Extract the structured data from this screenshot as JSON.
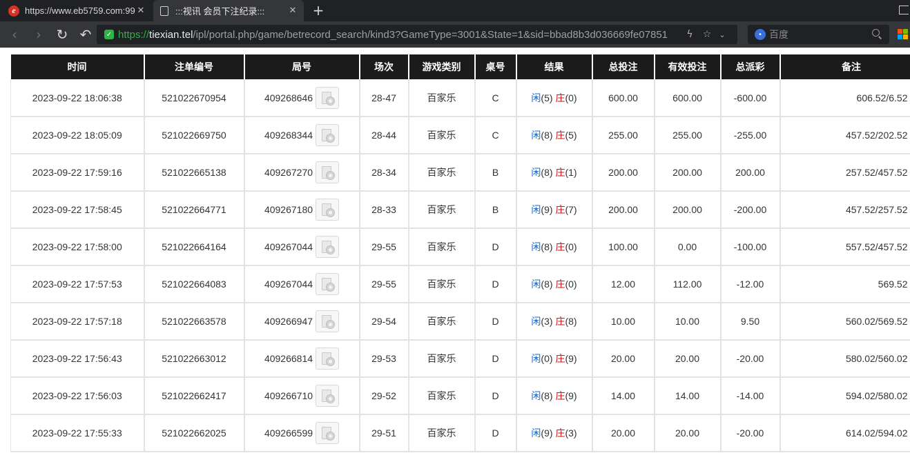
{
  "browser": {
    "tabs": [
      {
        "title": "https://www.eb5759.com:99",
        "active": false,
        "icon": "ie-logo-icon"
      },
      {
        "title": ":::视讯 会员下注纪录:::",
        "active": true,
        "icon": "document-icon"
      }
    ],
    "url": {
      "scheme": "https://",
      "host": "tiexian.tel",
      "path": "/ipl/portal.php/game/betrecord_search/kind3?GameType=3001&State=1&sid=bbad8b3d036669fe07851"
    },
    "search": {
      "placeholder": "百度"
    }
  },
  "table": {
    "headers": [
      "时间",
      "注单编号",
      "局号",
      "场次",
      "游戏类别",
      "桌号",
      "结果",
      "总投注",
      "有效投注",
      "总派彩",
      "备注"
    ],
    "rows": [
      {
        "time": "2023-09-22 18:06:38",
        "bet_id": "521022670954",
        "round": "409268646",
        "shoe": "28-47",
        "game": "百家乐",
        "table": "C",
        "player_label": "闲",
        "player_score": "(5)",
        "banker_label": "庄",
        "banker_score": "(0)",
        "total_bet": "600.00",
        "valid_bet": "600.00",
        "payout": "-600.00",
        "payout_sign": "neg",
        "note": "606.52/6.52"
      },
      {
        "time": "2023-09-22 18:05:09",
        "bet_id": "521022669750",
        "round": "409268344",
        "shoe": "28-44",
        "game": "百家乐",
        "table": "C",
        "player_label": "闲",
        "player_score": "(8)",
        "banker_label": "庄",
        "banker_score": "(5)",
        "total_bet": "255.00",
        "valid_bet": "255.00",
        "payout": "-255.00",
        "payout_sign": "neg",
        "note": "457.52/202.52"
      },
      {
        "time": "2023-09-22 17:59:16",
        "bet_id": "521022665138",
        "round": "409267270",
        "shoe": "28-34",
        "game": "百家乐",
        "table": "B",
        "player_label": "闲",
        "player_score": "(8)",
        "banker_label": "庄",
        "banker_score": "(1)",
        "total_bet": "200.00",
        "valid_bet": "200.00",
        "payout": "200.00",
        "payout_sign": "pos",
        "note": "257.52/457.52"
      },
      {
        "time": "2023-09-22 17:58:45",
        "bet_id": "521022664771",
        "round": "409267180",
        "shoe": "28-33",
        "game": "百家乐",
        "table": "B",
        "player_label": "闲",
        "player_score": "(9)",
        "banker_label": "庄",
        "banker_score": "(7)",
        "total_bet": "200.00",
        "valid_bet": "200.00",
        "payout": "-200.00",
        "payout_sign": "neg",
        "note": "457.52/257.52"
      },
      {
        "time": "2023-09-22 17:58:00",
        "bet_id": "521022664164",
        "round": "409267044",
        "shoe": "29-55",
        "game": "百家乐",
        "table": "D",
        "player_label": "闲",
        "player_score": "(8)",
        "banker_label": "庄",
        "banker_score": "(0)",
        "total_bet": "100.00",
        "valid_bet": "0.00",
        "payout": "-100.00",
        "payout_sign": "neg",
        "note": "557.52/457.52"
      },
      {
        "time": "2023-09-22 17:57:53",
        "bet_id": "521022664083",
        "round": "409267044",
        "shoe": "29-55",
        "game": "百家乐",
        "table": "D",
        "player_label": "闲",
        "player_score": "(8)",
        "banker_label": "庄",
        "banker_score": "(0)",
        "total_bet": "12.00",
        "valid_bet": "112.00",
        "payout": "-12.00",
        "payout_sign": "neg",
        "note": "569.52"
      },
      {
        "time": "2023-09-22 17:57:18",
        "bet_id": "521022663578",
        "round": "409266947",
        "shoe": "29-54",
        "game": "百家乐",
        "table": "D",
        "player_label": "闲",
        "player_score": "(3)",
        "banker_label": "庄",
        "banker_score": "(8)",
        "total_bet": "10.00",
        "valid_bet": "10.00",
        "payout": "9.50",
        "payout_sign": "pos",
        "note": "560.02/569.52"
      },
      {
        "time": "2023-09-22 17:56:43",
        "bet_id": "521022663012",
        "round": "409266814",
        "shoe": "29-53",
        "game": "百家乐",
        "table": "D",
        "player_label": "闲",
        "player_score": "(0)",
        "banker_label": "庄",
        "banker_score": "(9)",
        "total_bet": "20.00",
        "valid_bet": "20.00",
        "payout": "-20.00",
        "payout_sign": "neg",
        "note": "580.02/560.02"
      },
      {
        "time": "2023-09-22 17:56:03",
        "bet_id": "521022662417",
        "round": "409266710",
        "shoe": "29-52",
        "game": "百家乐",
        "table": "D",
        "player_label": "闲",
        "player_score": "(8)",
        "banker_label": "庄",
        "banker_score": "(9)",
        "total_bet": "14.00",
        "valid_bet": "14.00",
        "payout": "-14.00",
        "payout_sign": "neg",
        "note": "594.02/580.02"
      },
      {
        "time": "2023-09-22 17:55:33",
        "bet_id": "521022662025",
        "round": "409266599",
        "shoe": "29-51",
        "game": "百家乐",
        "table": "D",
        "player_label": "闲",
        "player_score": "(9)",
        "banker_label": "庄",
        "banker_score": "(3)",
        "total_bet": "20.00",
        "valid_bet": "20.00",
        "payout": "-20.00",
        "payout_sign": "neg",
        "note": "614.02/594.02"
      }
    ]
  },
  "colors": {
    "header_bg": "#1b1b1b",
    "blue": "#1a64c8",
    "red": "#cc1111",
    "grid": "#e2e2e2"
  }
}
